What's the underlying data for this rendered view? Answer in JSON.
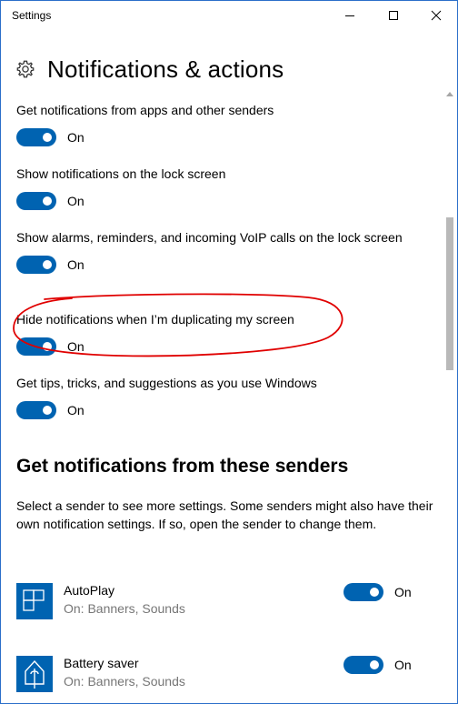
{
  "window": {
    "title": "Settings"
  },
  "header": {
    "title": "Notifications & actions",
    "icon": "gear-icon"
  },
  "settings": [
    {
      "label": "Get notifications from apps and other senders",
      "state": "On"
    },
    {
      "label": "Show notifications on the lock screen",
      "state": "On"
    },
    {
      "label": "Show alarms, reminders, and incoming VoIP calls on the lock screen",
      "state": "On"
    },
    {
      "label": "Hide notifications when I’m duplicating my screen",
      "state": "On"
    },
    {
      "label": "Get tips, tricks, and suggestions as you use Windows",
      "state": "On"
    }
  ],
  "senders_section": {
    "title": "Get notifications from these senders",
    "description": "Select a sender to see more settings. Some senders might also have their own notification settings. If so, open the sender to change them."
  },
  "senders": [
    {
      "name": "AutoPlay",
      "detail": "On: Banners, Sounds",
      "state": "On",
      "icon": "autoplay-icon"
    },
    {
      "name": "Battery saver",
      "detail": "On: Banners, Sounds",
      "state": "On",
      "icon": "battery-saver-icon"
    }
  ],
  "colors": {
    "accent": "#0063b1",
    "annotation": "#e00000",
    "border": "#2b6fc9"
  }
}
